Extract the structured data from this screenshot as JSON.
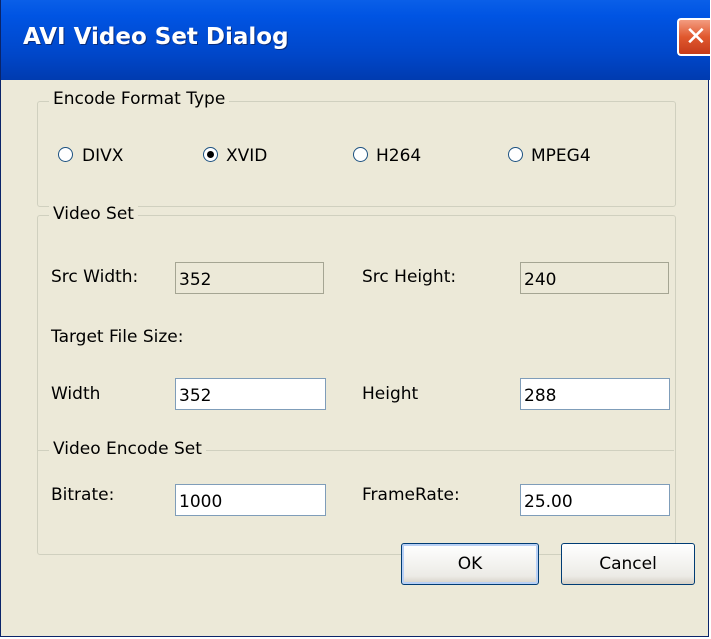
{
  "window": {
    "title": "AVI Video Set Dialog",
    "close_glyph": "✕"
  },
  "encode_format": {
    "legend": "Encode Format Type",
    "options": [
      {
        "label": "DIVX",
        "selected": false
      },
      {
        "label": "XVID",
        "selected": true
      },
      {
        "label": "H264",
        "selected": false
      },
      {
        "label": "MPEG4",
        "selected": false
      }
    ]
  },
  "video_set": {
    "legend": "Video Set",
    "src_width_label": "Src Width:",
    "src_width_value": "352",
    "src_height_label": "Src Height:",
    "src_height_value": "240",
    "target_label": "Target File Size:",
    "width_label": "Width",
    "width_value": "352",
    "height_label": "Height",
    "height_value": "288"
  },
  "encode_set": {
    "legend": "Video Encode Set",
    "bitrate_label": "Bitrate:",
    "bitrate_value": "1000",
    "framerate_label": "FrameRate:",
    "framerate_value": "25.00"
  },
  "buttons": {
    "ok": "OK",
    "cancel": "Cancel"
  },
  "colors": {
    "titlebar": "#0054e3",
    "dialog_bg": "#ece9d8",
    "close_button": "#e0582e"
  }
}
